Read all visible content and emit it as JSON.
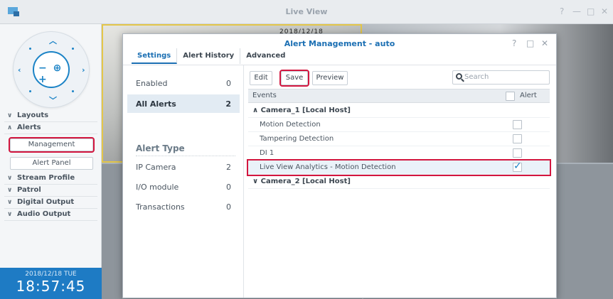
{
  "window": {
    "title": "Live View",
    "help": "?",
    "minimize": "—",
    "maximize": "□",
    "close": "✕"
  },
  "sidebar": {
    "nav": [
      {
        "label": "Layouts"
      },
      {
        "label": "Alerts"
      },
      {
        "label": "Management"
      },
      {
        "label": "Alert Panel"
      },
      {
        "label": "Stream Profile"
      },
      {
        "label": "Patrol"
      },
      {
        "label": "Digital Output"
      },
      {
        "label": "Audio Output"
      }
    ],
    "ptz": {
      "minus": "−",
      "plus": "+"
    },
    "clock": {
      "date": "2018/12/18 TUE",
      "time": "18:57:45"
    }
  },
  "feed": {
    "overlay_text": "2018/12/18  18:57:45"
  },
  "dialog": {
    "title": "Alert Management - auto",
    "help": "?",
    "restore": "□",
    "close": "✕",
    "tabs": [
      "Settings",
      "Alert History",
      "Advanced"
    ],
    "categories": [
      {
        "label": "Enabled",
        "count": "0"
      },
      {
        "label": "All Alerts",
        "count": "2"
      }
    ],
    "alert_type_header": "Alert Type",
    "types": [
      {
        "label": "IP Camera",
        "count": "2"
      },
      {
        "label": "I/O module",
        "count": "0"
      },
      {
        "label": "Transactions",
        "count": "0"
      }
    ],
    "toolbar": {
      "edit": "Edit",
      "save": "Save",
      "preview": "Preview",
      "search_placeholder": "Search"
    },
    "grid": {
      "col_events": "Events",
      "col_alert": "Alert",
      "groups": [
        {
          "label": "Camera_1 [Local Host]",
          "rows": [
            {
              "label": "Motion Detection",
              "checked": false
            },
            {
              "label": "Tampering Detection",
              "checked": false
            },
            {
              "label": "DI 1",
              "checked": false
            },
            {
              "label": "Live View Analytics - Motion Detection",
              "checked": true
            }
          ]
        },
        {
          "label": "Camera_2 [Local Host]",
          "rows": []
        }
      ]
    }
  },
  "colors": {
    "accent": "#1b83c6",
    "highlight": "#d3163f",
    "clock_bg": "#1e7bc4"
  }
}
